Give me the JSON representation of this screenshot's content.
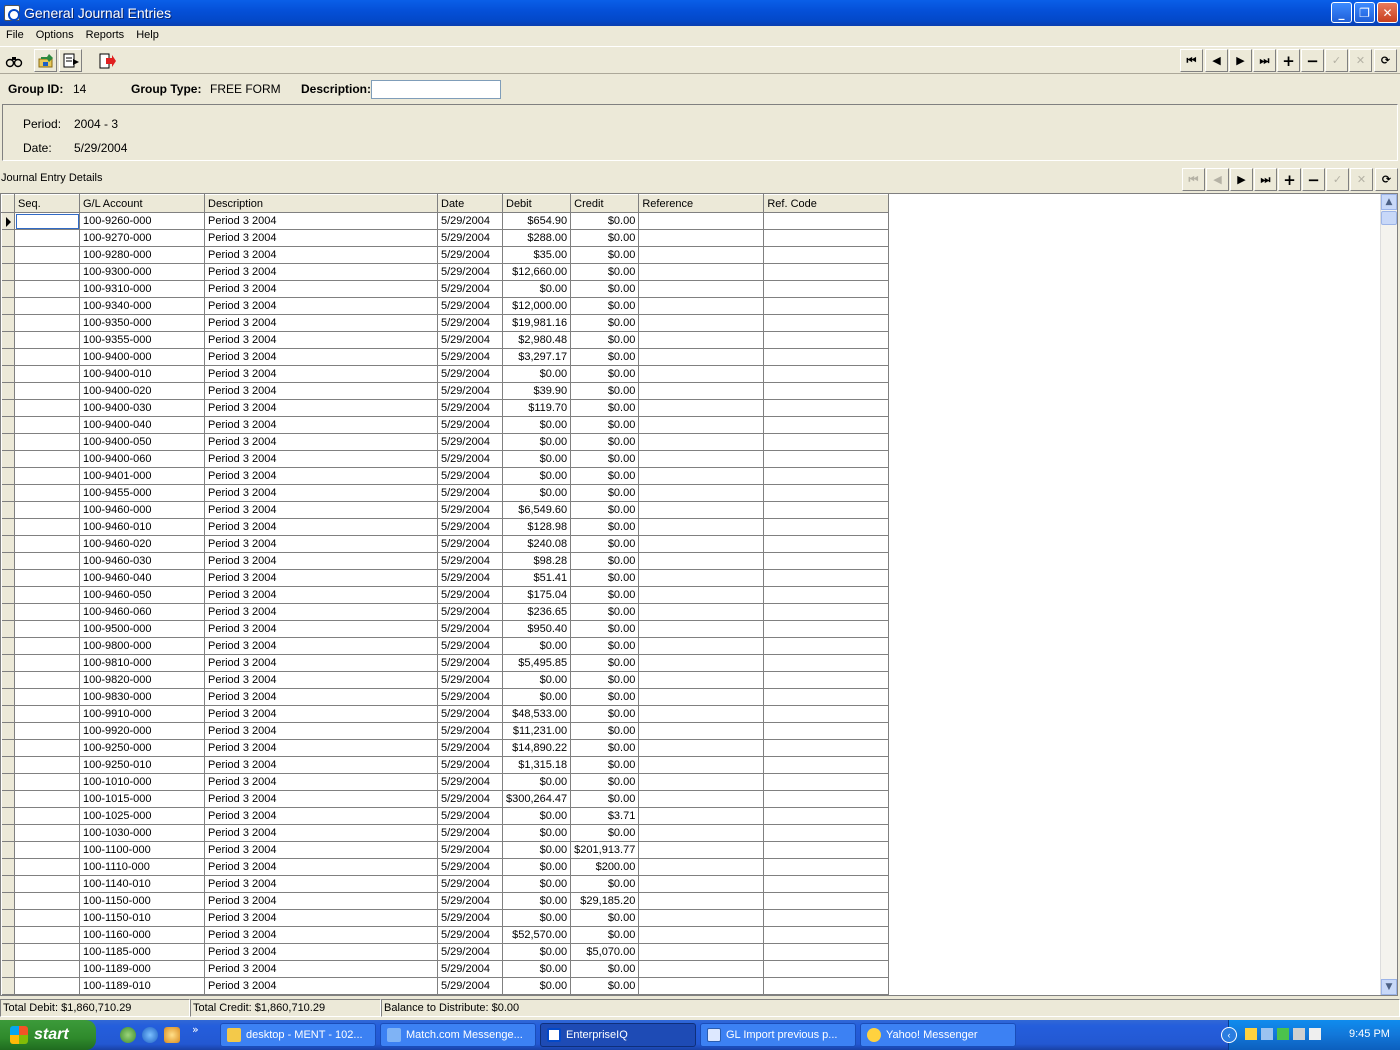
{
  "window": {
    "title": "General Journal Entries",
    "buttons": [
      "minimize",
      "restore",
      "close"
    ]
  },
  "menu": [
    "File",
    "Options",
    "Reports",
    "Help"
  ],
  "toolbar": {
    "left_icons": [
      "binoculars-icon",
      "folder-arrow-icon",
      "document-arrow-icon",
      "exit-icon"
    ],
    "nav_glyphs": {
      "first": "⏮",
      "prev": "◀",
      "next": "▶",
      "last": "⏭",
      "add": "+",
      "delete": "−",
      "post": "✓",
      "cancel": "✕",
      "refresh": "⟳"
    }
  },
  "header": {
    "group_id_label": "Group ID:",
    "group_id_value": "14",
    "group_type_label": "Group Type:",
    "group_type_value": "FREE FORM",
    "description_label": "Description:",
    "description_value": ""
  },
  "panel": {
    "period_label": "Period:",
    "period_value": "2004 - 3",
    "date_label": "Date:",
    "date_value": "5/29/2004"
  },
  "grid": {
    "title": "Journal Entry Details",
    "columns": [
      "Seq.",
      "G/L Account",
      "Description",
      "Date",
      "Debit",
      "Credit",
      "Reference",
      "Ref. Code"
    ],
    "rows": [
      [
        "",
        "100-9260-000",
        "Period 3 2004",
        "5/29/2004",
        "$654.90",
        "$0.00",
        "",
        ""
      ],
      [
        "",
        "100-9270-000",
        "Period 3 2004",
        "5/29/2004",
        "$288.00",
        "$0.00",
        "",
        ""
      ],
      [
        "",
        "100-9280-000",
        "Period 3 2004",
        "5/29/2004",
        "$35.00",
        "$0.00",
        "",
        ""
      ],
      [
        "",
        "100-9300-000",
        "Period 3 2004",
        "5/29/2004",
        "$12,660.00",
        "$0.00",
        "",
        ""
      ],
      [
        "",
        "100-9310-000",
        "Period 3 2004",
        "5/29/2004",
        "$0.00",
        "$0.00",
        "",
        ""
      ],
      [
        "",
        "100-9340-000",
        "Period 3 2004",
        "5/29/2004",
        "$12,000.00",
        "$0.00",
        "",
        ""
      ],
      [
        "",
        "100-9350-000",
        "Period 3 2004",
        "5/29/2004",
        "$19,981.16",
        "$0.00",
        "",
        ""
      ],
      [
        "",
        "100-9355-000",
        "Period 3 2004",
        "5/29/2004",
        "$2,980.48",
        "$0.00",
        "",
        ""
      ],
      [
        "",
        "100-9400-000",
        "Period 3 2004",
        "5/29/2004",
        "$3,297.17",
        "$0.00",
        "",
        ""
      ],
      [
        "",
        "100-9400-010",
        "Period 3 2004",
        "5/29/2004",
        "$0.00",
        "$0.00",
        "",
        ""
      ],
      [
        "",
        "100-9400-020",
        "Period 3 2004",
        "5/29/2004",
        "$39.90",
        "$0.00",
        "",
        ""
      ],
      [
        "",
        "100-9400-030",
        "Period 3 2004",
        "5/29/2004",
        "$119.70",
        "$0.00",
        "",
        ""
      ],
      [
        "",
        "100-9400-040",
        "Period 3 2004",
        "5/29/2004",
        "$0.00",
        "$0.00",
        "",
        ""
      ],
      [
        "",
        "100-9400-050",
        "Period 3 2004",
        "5/29/2004",
        "$0.00",
        "$0.00",
        "",
        ""
      ],
      [
        "",
        "100-9400-060",
        "Period 3 2004",
        "5/29/2004",
        "$0.00",
        "$0.00",
        "",
        ""
      ],
      [
        "",
        "100-9401-000",
        "Period 3 2004",
        "5/29/2004",
        "$0.00",
        "$0.00",
        "",
        ""
      ],
      [
        "",
        "100-9455-000",
        "Period 3 2004",
        "5/29/2004",
        "$0.00",
        "$0.00",
        "",
        ""
      ],
      [
        "",
        "100-9460-000",
        "Period 3 2004",
        "5/29/2004",
        "$6,549.60",
        "$0.00",
        "",
        ""
      ],
      [
        "",
        "100-9460-010",
        "Period 3 2004",
        "5/29/2004",
        "$128.98",
        "$0.00",
        "",
        ""
      ],
      [
        "",
        "100-9460-020",
        "Period 3 2004",
        "5/29/2004",
        "$240.08",
        "$0.00",
        "",
        ""
      ],
      [
        "",
        "100-9460-030",
        "Period 3 2004",
        "5/29/2004",
        "$98.28",
        "$0.00",
        "",
        ""
      ],
      [
        "",
        "100-9460-040",
        "Period 3 2004",
        "5/29/2004",
        "$51.41",
        "$0.00",
        "",
        ""
      ],
      [
        "",
        "100-9460-050",
        "Period 3 2004",
        "5/29/2004",
        "$175.04",
        "$0.00",
        "",
        ""
      ],
      [
        "",
        "100-9460-060",
        "Period 3 2004",
        "5/29/2004",
        "$236.65",
        "$0.00",
        "",
        ""
      ],
      [
        "",
        "100-9500-000",
        "Period 3 2004",
        "5/29/2004",
        "$950.40",
        "$0.00",
        "",
        ""
      ],
      [
        "",
        "100-9800-000",
        "Period 3 2004",
        "5/29/2004",
        "$0.00",
        "$0.00",
        "",
        ""
      ],
      [
        "",
        "100-9810-000",
        "Period 3 2004",
        "5/29/2004",
        "$5,495.85",
        "$0.00",
        "",
        ""
      ],
      [
        "",
        "100-9820-000",
        "Period 3 2004",
        "5/29/2004",
        "$0.00",
        "$0.00",
        "",
        ""
      ],
      [
        "",
        "100-9830-000",
        "Period 3 2004",
        "5/29/2004",
        "$0.00",
        "$0.00",
        "",
        ""
      ],
      [
        "",
        "100-9910-000",
        "Period 3 2004",
        "5/29/2004",
        "$48,533.00",
        "$0.00",
        "",
        ""
      ],
      [
        "",
        "100-9920-000",
        "Period 3 2004",
        "5/29/2004",
        "$11,231.00",
        "$0.00",
        "",
        ""
      ],
      [
        "",
        "100-9250-000",
        "Period 3 2004",
        "5/29/2004",
        "$14,890.22",
        "$0.00",
        "",
        ""
      ],
      [
        "",
        "100-9250-010",
        "Period 3 2004",
        "5/29/2004",
        "$1,315.18",
        "$0.00",
        "",
        ""
      ],
      [
        "",
        "100-1010-000",
        "Period 3 2004",
        "5/29/2004",
        "$0.00",
        "$0.00",
        "",
        ""
      ],
      [
        "",
        "100-1015-000",
        "Period 3 2004",
        "5/29/2004",
        "$300,264.47",
        "$0.00",
        "",
        ""
      ],
      [
        "",
        "100-1025-000",
        "Period 3 2004",
        "5/29/2004",
        "$0.00",
        "$3.71",
        "",
        ""
      ],
      [
        "",
        "100-1030-000",
        "Period 3 2004",
        "5/29/2004",
        "$0.00",
        "$0.00",
        "",
        ""
      ],
      [
        "",
        "100-1100-000",
        "Period 3 2004",
        "5/29/2004",
        "$0.00",
        "$201,913.77",
        "",
        ""
      ],
      [
        "",
        "100-1110-000",
        "Period 3 2004",
        "5/29/2004",
        "$0.00",
        "$200.00",
        "",
        ""
      ],
      [
        "",
        "100-1140-010",
        "Period 3 2004",
        "5/29/2004",
        "$0.00",
        "$0.00",
        "",
        ""
      ],
      [
        "",
        "100-1150-000",
        "Period 3 2004",
        "5/29/2004",
        "$0.00",
        "$29,185.20",
        "",
        ""
      ],
      [
        "",
        "100-1150-010",
        "Period 3 2004",
        "5/29/2004",
        "$0.00",
        "$0.00",
        "",
        ""
      ],
      [
        "",
        "100-1160-000",
        "Period 3 2004",
        "5/29/2004",
        "$52,570.00",
        "$0.00",
        "",
        ""
      ],
      [
        "",
        "100-1185-000",
        "Period 3 2004",
        "5/29/2004",
        "$0.00",
        "$5,070.00",
        "",
        ""
      ],
      [
        "",
        "100-1189-000",
        "Period 3 2004",
        "5/29/2004",
        "$0.00",
        "$0.00",
        "",
        ""
      ],
      [
        "",
        "100-1189-010",
        "Period 3 2004",
        "5/29/2004",
        "$0.00",
        "$0.00",
        "",
        ""
      ]
    ]
  },
  "status": {
    "total_debit": "Total Debit: $1,860,710.29",
    "total_credit": "Total Credit: $1,860,710.29",
    "balance": "Balance to Distribute: $0.00"
  },
  "taskbar": {
    "start_label": "start",
    "tasks": [
      {
        "label": "desktop - MENT - 102...",
        "icon": "folder-icon",
        "active": false
      },
      {
        "label": "Match.com Messenge...",
        "icon": "messenger-icon",
        "active": false
      },
      {
        "label": "EnterpriseIQ",
        "icon": "enterpriseiq-icon",
        "active": true
      },
      {
        "label": "GL Import previous p...",
        "icon": "word-document-icon",
        "active": false
      },
      {
        "label": "Yahoo! Messenger",
        "icon": "yahoo-smiley-icon",
        "active": false
      }
    ],
    "clock": "9:45 PM"
  },
  "colors": {
    "titlebar": "#0550D8",
    "window_bg": "#ECE9D8",
    "taskbar": "#245EDC",
    "start_green": "#3C9A3A"
  }
}
